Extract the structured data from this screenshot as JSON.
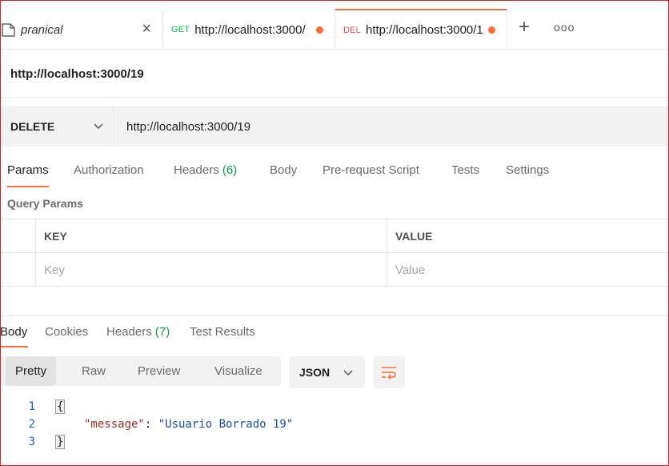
{
  "tabs": [
    {
      "title": "pranical",
      "style": "italic",
      "closable": true
    },
    {
      "method": "GET",
      "url": "http://localhost:3000/",
      "unsaved": true
    },
    {
      "method": "DEL",
      "url": "http://localhost:3000/1",
      "unsaved": true,
      "active": true
    }
  ],
  "tab_actions": {
    "new_tab": "+",
    "more": "ooo"
  },
  "request": {
    "name": "http://localhost:3000/19",
    "method": "DELETE",
    "url": "http://localhost:3000/19"
  },
  "request_tabs": [
    {
      "label": "Params",
      "active": true
    },
    {
      "label": "Authorization"
    },
    {
      "label": "Headers",
      "count": "(6)"
    },
    {
      "label": "Body"
    },
    {
      "label": "Pre-request Script"
    },
    {
      "label": "Tests"
    },
    {
      "label": "Settings"
    }
  ],
  "query_params": {
    "title": "Query Params",
    "headers": {
      "key": "KEY",
      "value": "VALUE"
    },
    "placeholders": {
      "key": "Key",
      "value": "Value"
    }
  },
  "response_tabs": [
    {
      "label": "Body",
      "active": true
    },
    {
      "label": "Cookies"
    },
    {
      "label": "Headers",
      "count": "(7)"
    },
    {
      "label": "Test Results"
    }
  ],
  "response_view": {
    "modes": [
      "Pretty",
      "Raw",
      "Preview",
      "Visualize"
    ],
    "active_mode": "Pretty",
    "format": "JSON"
  },
  "response_body": {
    "line_numbers": [
      "1",
      "2",
      "3"
    ],
    "open_brace": "{",
    "key": "\"message\"",
    "colon": ": ",
    "value": "\"Usuario Borrado 19\"",
    "close_brace": "}"
  },
  "colors": {
    "accent": "#ff6c37",
    "get": "#0cbb52",
    "delete": "#e0524c",
    "count": "#0b9b45"
  }
}
